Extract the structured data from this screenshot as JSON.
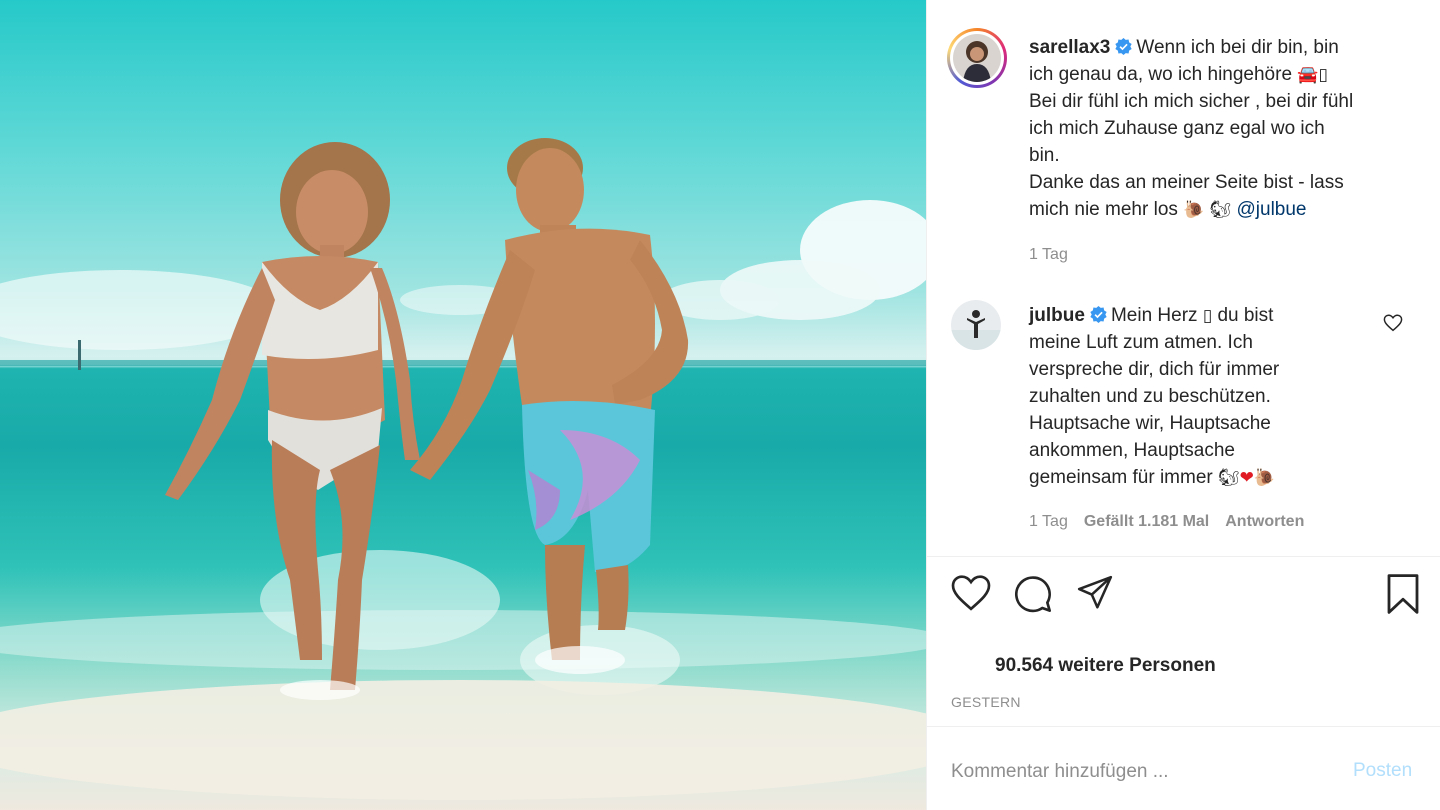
{
  "post": {
    "author": "sarellax3",
    "caption": {
      "line1": "Wenn ich bei dir bin, bin",
      "line2": "ich genau da, wo ich hingehöre",
      "line3": "Bei dir fühl ich mich sicher , bei dir fühl",
      "line4": "ich mich Zuhause ganz egal wo ich",
      "line5": "bin.",
      "line6": "Danke das an meiner Seite bist - lass",
      "line7": "mich nie mehr los",
      "mention": "@julbue"
    },
    "time": "1 Tag"
  },
  "comment": {
    "author": "julbue",
    "text": {
      "line1a": "Mein Herz",
      "line1b": "du bist",
      "line2": "meine Luft zum atmen. Ich",
      "line3": "verspreche dir, dich für immer",
      "line4": "zuhalten und zu beschützen.",
      "line5": "Hauptsache wir, Hauptsache",
      "line6": "ankommen, Hauptsache",
      "line7": "gemeinsam für immer"
    },
    "time": "1 Tag",
    "likes": "Gefällt 1.181 Mal",
    "reply": "Antworten"
  },
  "actions": {
    "like_icon": "heart-icon",
    "comment_icon": "comment-icon",
    "share_icon": "paper-plane-icon",
    "save_icon": "bookmark-icon"
  },
  "likes_text": "90.564 weitere Personen",
  "date_label": "GESTERN",
  "comment_box": {
    "placeholder": "Kommentar hinzufügen ...",
    "submit_label": "Posten"
  },
  "colors": {
    "verified": "#3897f0",
    "mention": "#00376b",
    "muted": "#8e8e8e",
    "post_button": "#b2dffc"
  }
}
